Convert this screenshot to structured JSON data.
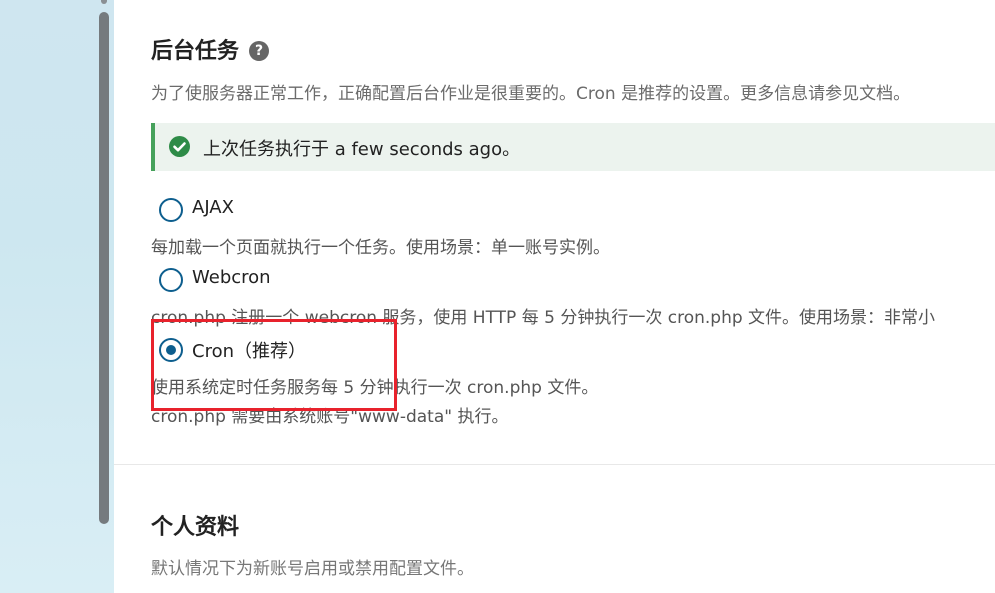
{
  "background_jobs": {
    "title": "后台任务",
    "help_icon": "question-circle-icon",
    "description": "为了使服务器正常工作，正确配置后台作业是很重要的。Cron 是推荐的设置。更多信息请参见文档。",
    "notice": {
      "icon": "check-circle-icon",
      "text": "上次任务执行于 a few seconds ago。",
      "accent_color": "#46a15b"
    },
    "options": [
      {
        "label": "AJAX",
        "selected": false,
        "description": "每加载一个页面就执行一个任务。使用场景：单一账号实例。"
      },
      {
        "label": "Webcron",
        "selected": false,
        "description": "cron.php 注册一个 webcron 服务，使用 HTTP 每 5 分钟执行一次 cron.php 文件。使用场景：非常小"
      },
      {
        "label": "Cron（推荐）",
        "selected": true,
        "description": "使用系统定时任务服务每 5 分钟执行一次 cron.php 文件。",
        "description2": "cron.php 需要由系统账号\"www-data\" 执行。"
      }
    ],
    "radio_color": "#0d5e8e",
    "highlight_color": "#e8222c"
  },
  "profile": {
    "title": "个人资料",
    "description": "默认情况下为新账号启用或禁用配置文件。"
  }
}
